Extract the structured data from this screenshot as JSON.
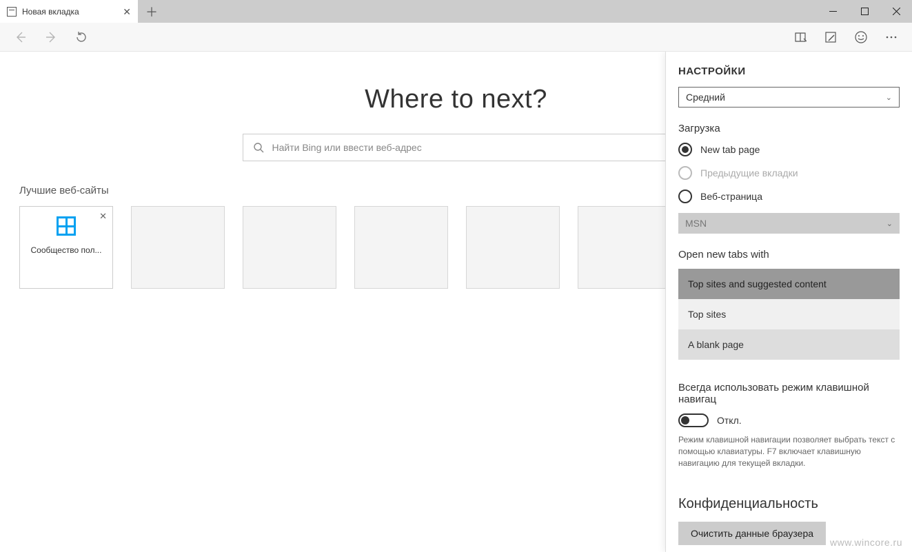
{
  "tab": {
    "title": "Новая вкладка"
  },
  "toolbar": {
    "back": "Назад",
    "forward": "Вперёд",
    "refresh": "Обновить"
  },
  "page": {
    "headline": "Where to next?",
    "search_placeholder": "Найти Bing или ввести веб-адрес",
    "top_sites_label": "Лучшие веб-сайты",
    "tile0_label": "Сообщество пол..."
  },
  "settings": {
    "title": "НАСТРОЙКИ",
    "theme_select": "Средний",
    "startup_label": "Загрузка",
    "radio_newtab": "New tab page",
    "radio_prev": "Предыдущие вкладки",
    "radio_webpage": "Веб-страница",
    "webpage_select": "MSN",
    "open_tabs_label": "Open new tabs with",
    "opt_top_suggested": "Top sites and suggested content",
    "opt_top": "Top sites",
    "opt_blank": "A blank page",
    "caret_label": "Всегда использовать режим клавишной навигац",
    "toggle_state": "Откл.",
    "caret_help": "Режим клавишной навигации позволяет выбрать текст с помощью клавиатуры. F7 включает клавишную навигацию для текущей вкладки.",
    "privacy_heading": "Конфиденциальность",
    "clear_data_btn": "Очистить данные браузера"
  },
  "watermark": "www.wincore.ru"
}
